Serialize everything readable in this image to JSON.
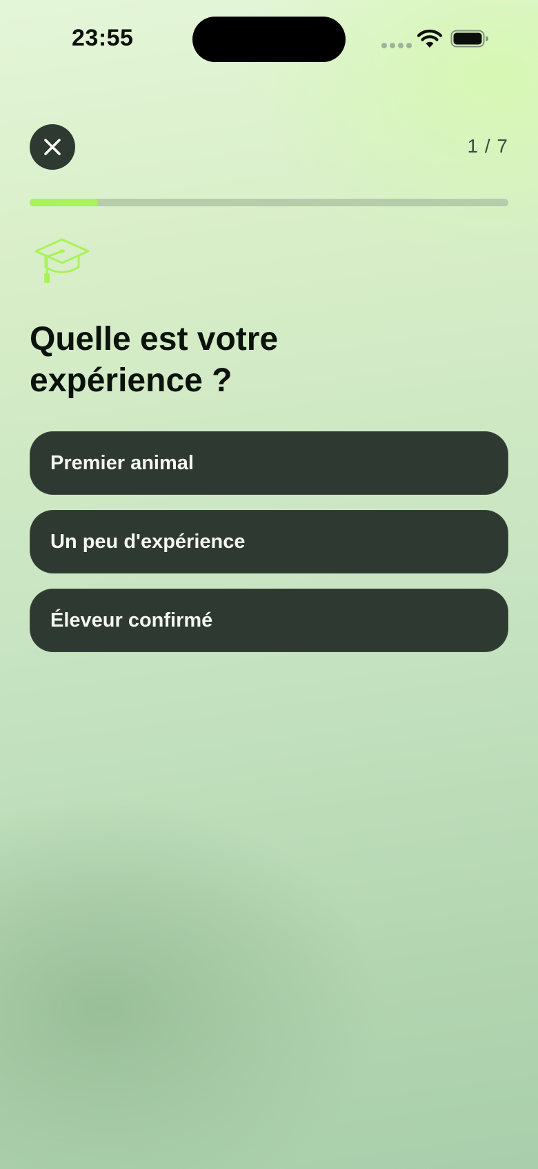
{
  "status_bar": {
    "time": "23:55"
  },
  "header": {
    "close_icon": "close-icon",
    "step_counter": "1 / 7"
  },
  "progress": {
    "current_step": 1,
    "total_steps": 7,
    "fraction": 0.143,
    "fill_color": "#a9f25a",
    "track_color": "#b6ccaa"
  },
  "question": {
    "icon": "graduation-cap-icon",
    "icon_color": "#a9f25a",
    "title": "Quelle est votre expérience ?"
  },
  "options": [
    {
      "label": "Premier animal"
    },
    {
      "label": "Un peu d'expérience"
    },
    {
      "label": "Éleveur confirmé"
    }
  ],
  "colors": {
    "button_bg": "#2e3a31",
    "button_text": "#f4f7f2",
    "title_text": "#0a120b"
  }
}
